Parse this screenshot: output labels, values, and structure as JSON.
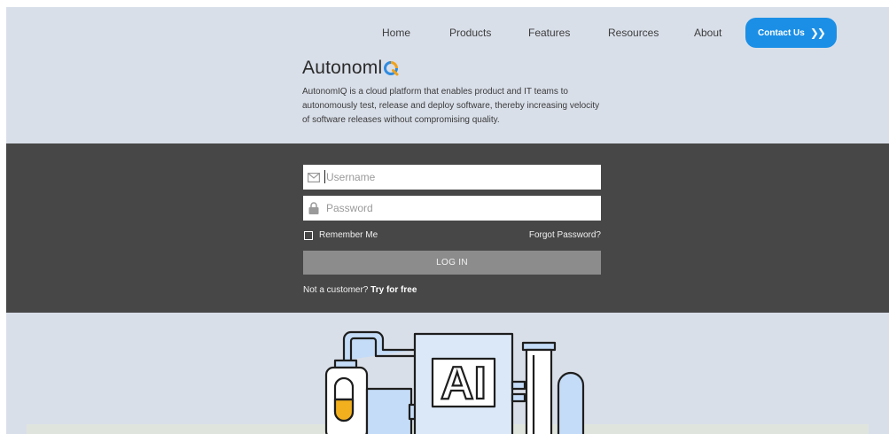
{
  "nav": {
    "items": [
      {
        "label": "Home"
      },
      {
        "label": "Products"
      },
      {
        "label": "Features"
      },
      {
        "label": "Resources"
      },
      {
        "label": "About"
      }
    ],
    "contact_label": "Contact Us",
    "contact_icon": "double-chevron-right-icon"
  },
  "brand": {
    "name": "Autonoml",
    "name_suffix_icon": "q-ring-icon",
    "tagline": "AutonomIQ is a cloud platform that enables product and IT teams to autonomously test, release and deploy software, thereby increasing velocity of software releases without compromising quality."
  },
  "login": {
    "username_placeholder": "Username",
    "username_icon": "mail-icon",
    "password_placeholder": "Password",
    "password_icon": "lock-icon",
    "remember_label": "Remember Me",
    "forgot_label": "Forgot Password?",
    "login_label": "LOG IN",
    "not_customer_text": "Not a customer?",
    "try_free_label": "Try for free"
  },
  "illustration": {
    "label": "AI"
  },
  "colors": {
    "accent": "#1b8fe6",
    "band_light": "#d9dfe9",
    "band_dark": "#474747",
    "logo_q_blue": "#2f8be0",
    "logo_q_orange": "#f0a21c",
    "tank_yellow": "#f2b01e",
    "illustration_blue": "#c4dcf7"
  }
}
